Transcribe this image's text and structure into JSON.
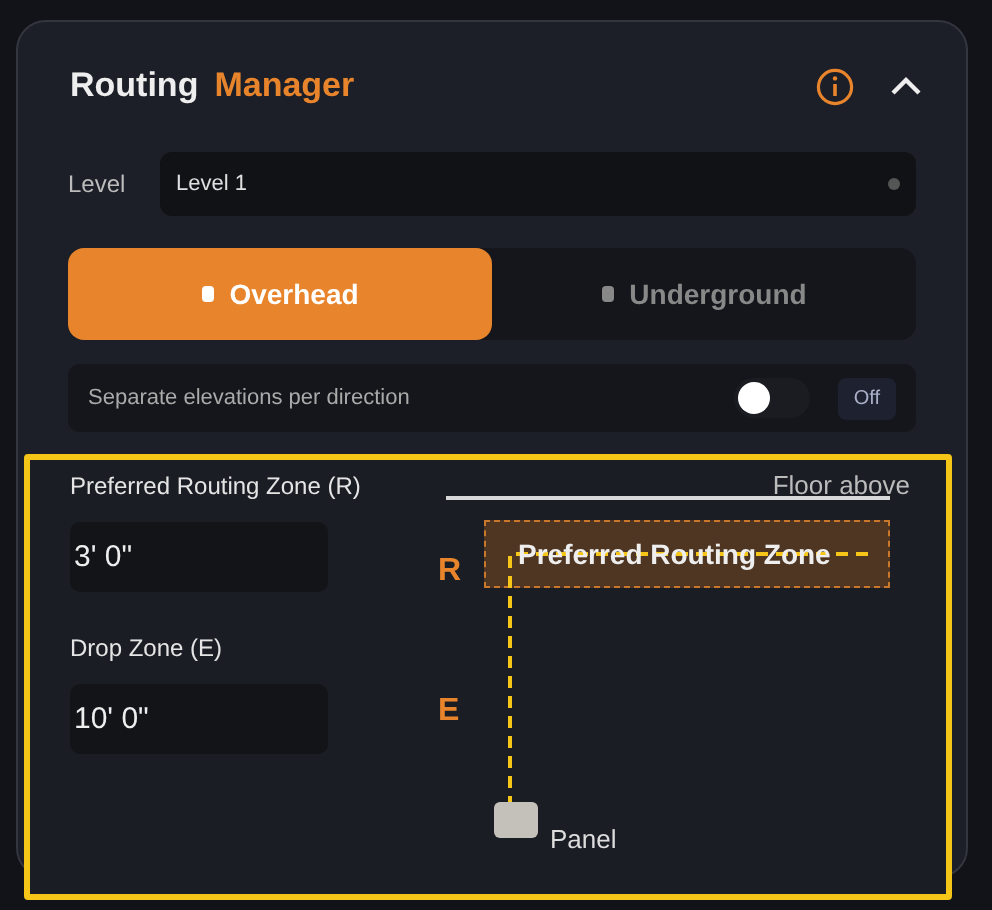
{
  "header": {
    "title": "Routing",
    "title_accent": "Manager",
    "expanded": true
  },
  "level": {
    "label": "Level",
    "value": "Level 1"
  },
  "placement": [
    {
      "label": "Overhead",
      "selected": true
    },
    {
      "label": "Underground",
      "selected": false
    }
  ],
  "separate_elevations": {
    "label": "Separate elevations per direction",
    "on": false,
    "badge": "Off"
  },
  "fields": [
    {
      "label": "Preferred Routing Zone (R)",
      "value": "3' 0\""
    },
    {
      "label": "Drop Zone (E)",
      "value": "10' 0\""
    }
  ],
  "diagram": {
    "floor_label": "Floor above",
    "zone_label": "Preferred Routing Zone",
    "r_marker": "R",
    "e_marker": "E",
    "panel_label": "Panel"
  }
}
